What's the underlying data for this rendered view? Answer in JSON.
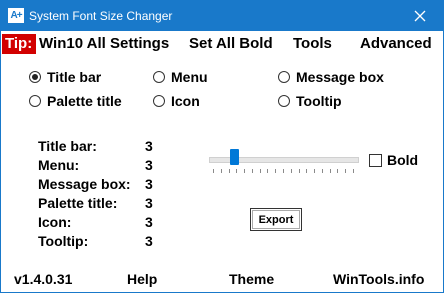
{
  "window": {
    "title": "System Font Size Changer",
    "icon_text": "A+",
    "accent_color": "#1979ca"
  },
  "menu": {
    "tip": "Tip:",
    "items": [
      "Win10 All Settings",
      "Set All Bold",
      "Tools",
      "Advanced"
    ]
  },
  "options": [
    {
      "label": "Title bar",
      "checked": true
    },
    {
      "label": "Menu",
      "checked": false
    },
    {
      "label": "Message box",
      "checked": false
    },
    {
      "label": "Palette title",
      "checked": false
    },
    {
      "label": "Icon",
      "checked": false
    },
    {
      "label": "Tooltip",
      "checked": false
    }
  ],
  "sizes": [
    {
      "label": "Title bar:",
      "value": "3"
    },
    {
      "label": "Menu:",
      "value": "3"
    },
    {
      "label": "Message box:",
      "value": "3"
    },
    {
      "label": "Palette title:",
      "value": "3"
    },
    {
      "label": "Icon:",
      "value": "3"
    },
    {
      "label": "Tooltip:",
      "value": "3"
    }
  ],
  "slider": {
    "value_fraction": 0.15
  },
  "bold": {
    "label": "Bold",
    "checked": false
  },
  "export_label": "Export",
  "footer": {
    "version": "v1.4.0.31",
    "help": "Help",
    "theme": "Theme",
    "site": "WinTools.info"
  }
}
